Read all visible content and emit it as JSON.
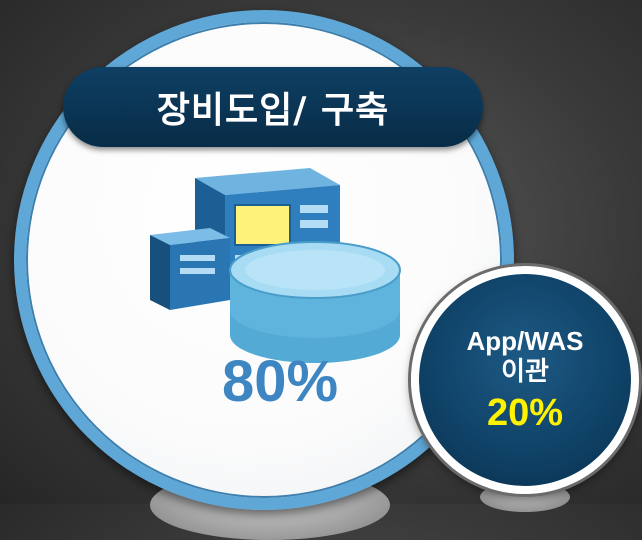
{
  "main_block": {
    "title": "장비도입/ 구축",
    "percent": "80%",
    "icon": "server-database-icon"
  },
  "side_block": {
    "label_line1": "App/WAS",
    "label_line2": "이관",
    "percent": "20%"
  },
  "colors": {
    "ring": "#5fa7d6",
    "title_bg": "#0e3f63",
    "big_percent": "#3e86c2",
    "small_percent": "#fff200",
    "small_bg": "#0e3f63"
  }
}
